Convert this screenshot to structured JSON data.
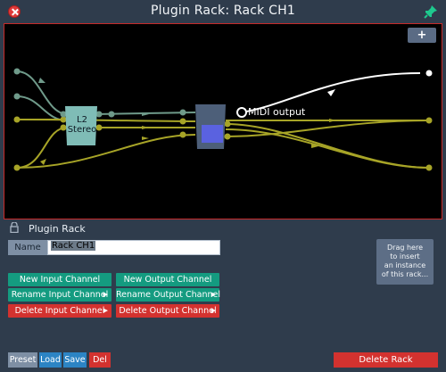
{
  "window": {
    "title": "Plugin Rack: Rack CH1"
  },
  "graph": {
    "add_label": "+",
    "node_l2_line1": "L2",
    "node_l2_line2": "Stereo",
    "midi_output_label": "MIDI output"
  },
  "panel": {
    "title": "Plugin Rack",
    "name_label": "Name",
    "name_value": "Rack CH1",
    "buttons": {
      "new_input": "New Input Channel",
      "new_output": "New Output Channel",
      "rename_input": "Rename Input Channel",
      "rename_output": "Rename Output Channel",
      "delete_input": "Delete Input Channel",
      "delete_output": "Delete Output Channel"
    },
    "drag_hint_lines": [
      "Drag here",
      "to insert",
      "an instance",
      "of this rack..."
    ],
    "preset_bar": {
      "preset": "Preset",
      "load": "Load",
      "save": "Save",
      "del": "Del"
    },
    "delete_rack": "Delete Rack"
  },
  "colors": {
    "accent_green": "#149b80",
    "accent_red": "#d3322f",
    "wire_olive": "#a7a427",
    "wire_sage": "#6f9a8a",
    "node_teal": "#7fbcb6",
    "node_slate": "#4d5f79",
    "node_blue": "#5a62e0"
  },
  "icons": {
    "close": "close-icon",
    "pin": "pin-icon",
    "lock": "lock-icon",
    "arrow": "triangle-right-icon"
  }
}
